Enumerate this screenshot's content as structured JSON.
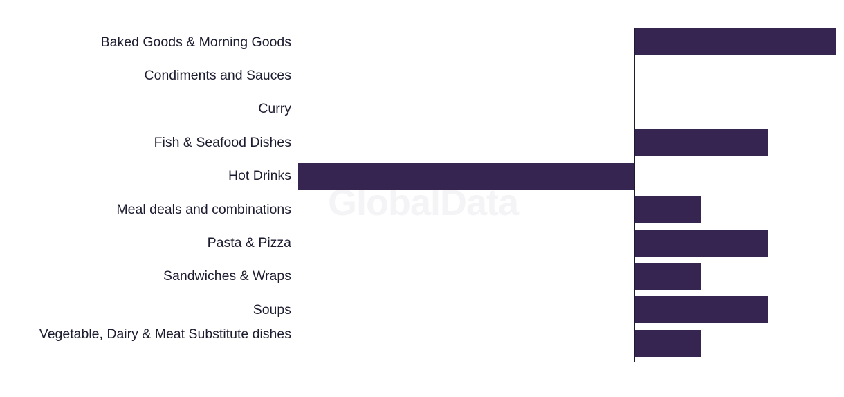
{
  "watermark": {
    "text": "GlobalData"
  },
  "chart": {
    "background_color": "#ffffff",
    "bar_color": "#362451",
    "axis_color": "#1c1c30",
    "label_color": "#1c1c30",
    "watermark_color": "#f4f4f6"
  },
  "chart_data": {
    "type": "bar",
    "orientation": "horizontal",
    "title": "",
    "subtitle": "",
    "xlabel": "",
    "ylabel": "",
    "grid": false,
    "legend": false,
    "axis_tick_labels": [],
    "zero_line": true,
    "xlim": [
      -5,
      3
    ],
    "categories": [
      "Baked Goods & Morning Goods",
      "Condiments and Sauces",
      "Curry",
      "Fish & Seafood Dishes",
      "Hot Drinks",
      "Meal deals and combinations",
      "Pasta & Pizza",
      "Sandwiches & Wraps",
      "Soups",
      "Vegetable, Dairy & Meat Substitute dishes"
    ],
    "values": [
      3,
      0,
      0,
      2,
      -5,
      1,
      2,
      1,
      2,
      1
    ],
    "annotations": [
      "GlobalData"
    ]
  }
}
